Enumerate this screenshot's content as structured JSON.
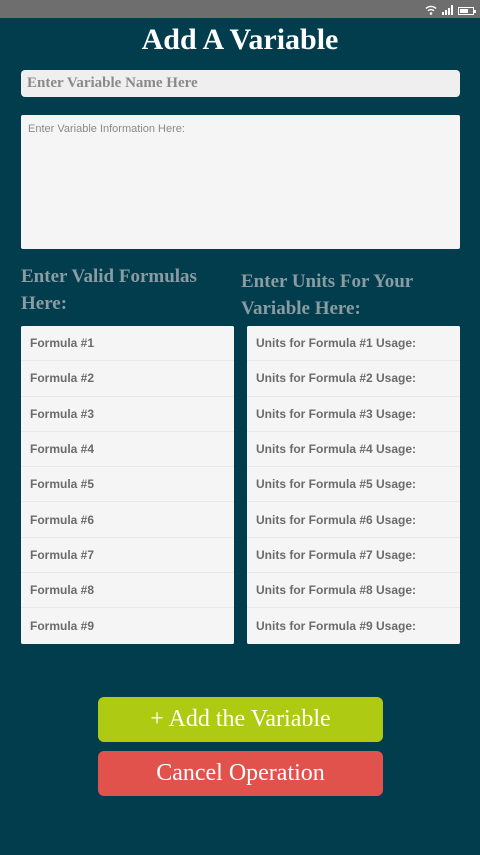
{
  "header": {
    "title": "Add A Variable"
  },
  "name_field": {
    "placeholder": "Enter Variable Name Here"
  },
  "info_field": {
    "placeholder": "Enter Variable Information Here:"
  },
  "formulas": {
    "heading": "Enter Valid Formulas Here:",
    "items": [
      "Formula #1",
      "Formula #2",
      "Formula #3",
      "Formula #4",
      "Formula #5",
      "Formula #6",
      "Formula #7",
      "Formula #8",
      "Formula #9"
    ]
  },
  "units": {
    "heading": "Enter Units For Your Variable Here:",
    "items": [
      "Units for Formula #1 Usage:",
      "Units for Formula #2 Usage:",
      "Units for Formula #3 Usage:",
      "Units for Formula #4 Usage:",
      "Units for Formula #5 Usage:",
      "Units for Formula #6 Usage:",
      "Units for Formula #7 Usage:",
      "Units for Formula #8 Usage:",
      "Units for Formula #9 Usage:"
    ]
  },
  "actions": {
    "add_label": "+ Add the Variable",
    "cancel_label": "Cancel Operation",
    "add_color": "#afca12",
    "cancel_color": "#e1524c"
  },
  "theme": {
    "background": "#023d4d",
    "heading_color": "#8a9ba2"
  }
}
